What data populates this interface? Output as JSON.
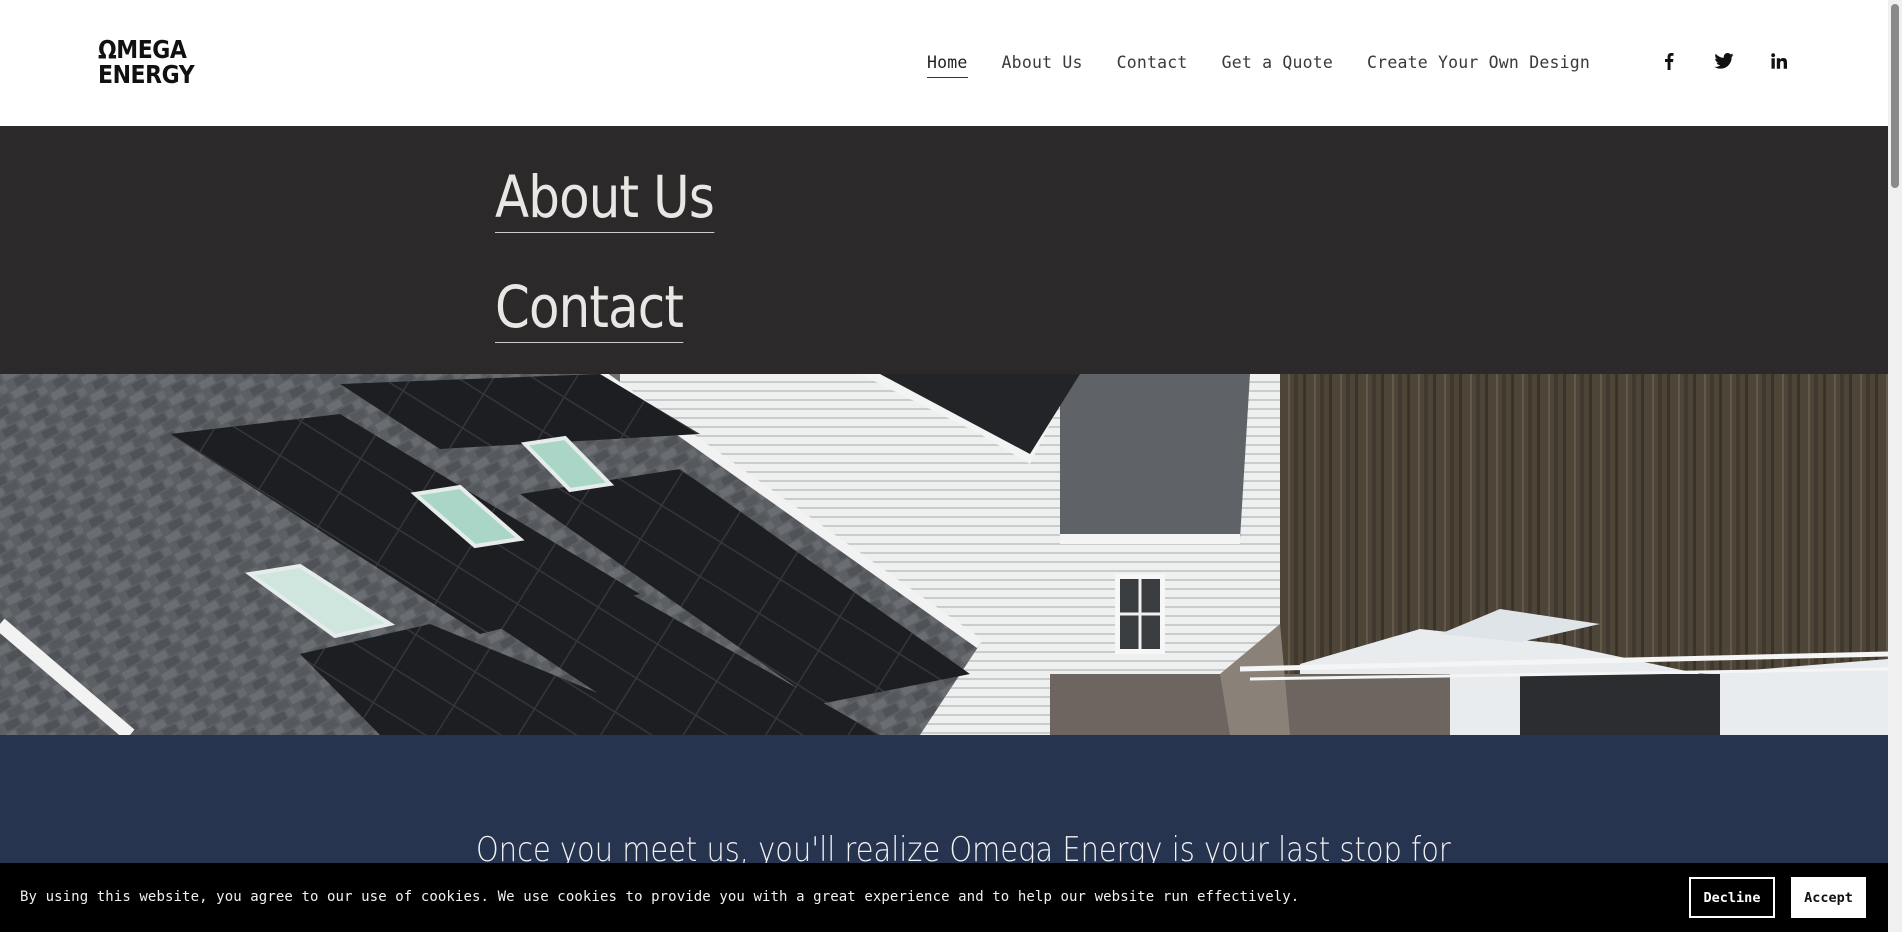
{
  "header": {
    "logo_line1": "ΩMEGA",
    "logo_line2": "ENERGY",
    "nav": [
      {
        "label": "Home",
        "active": true
      },
      {
        "label": "About Us"
      },
      {
        "label": "Contact"
      },
      {
        "label": "Get a Quote"
      },
      {
        "label": "Create Your Own Design"
      }
    ],
    "social_icons": [
      "facebook-icon",
      "twitter-icon",
      "linkedin-icon"
    ]
  },
  "hero_links": {
    "about": "About Us",
    "contact": "Contact"
  },
  "photo": {
    "description_icon": "solar-panels-house-aerial"
  },
  "tagline": {
    "text": "Once you meet us, you'll realize Omega Energy is your last stop for"
  },
  "cookie_banner": {
    "text": "By using this website, you agree to our use of cookies. We use cookies to provide you with a great experience and to help our website run effectively.",
    "decline": "Decline",
    "accept": "Accept"
  },
  "colors": {
    "dark_section": "#2b292a",
    "navy_section": "#263450",
    "cookie_bar": "#000000"
  }
}
